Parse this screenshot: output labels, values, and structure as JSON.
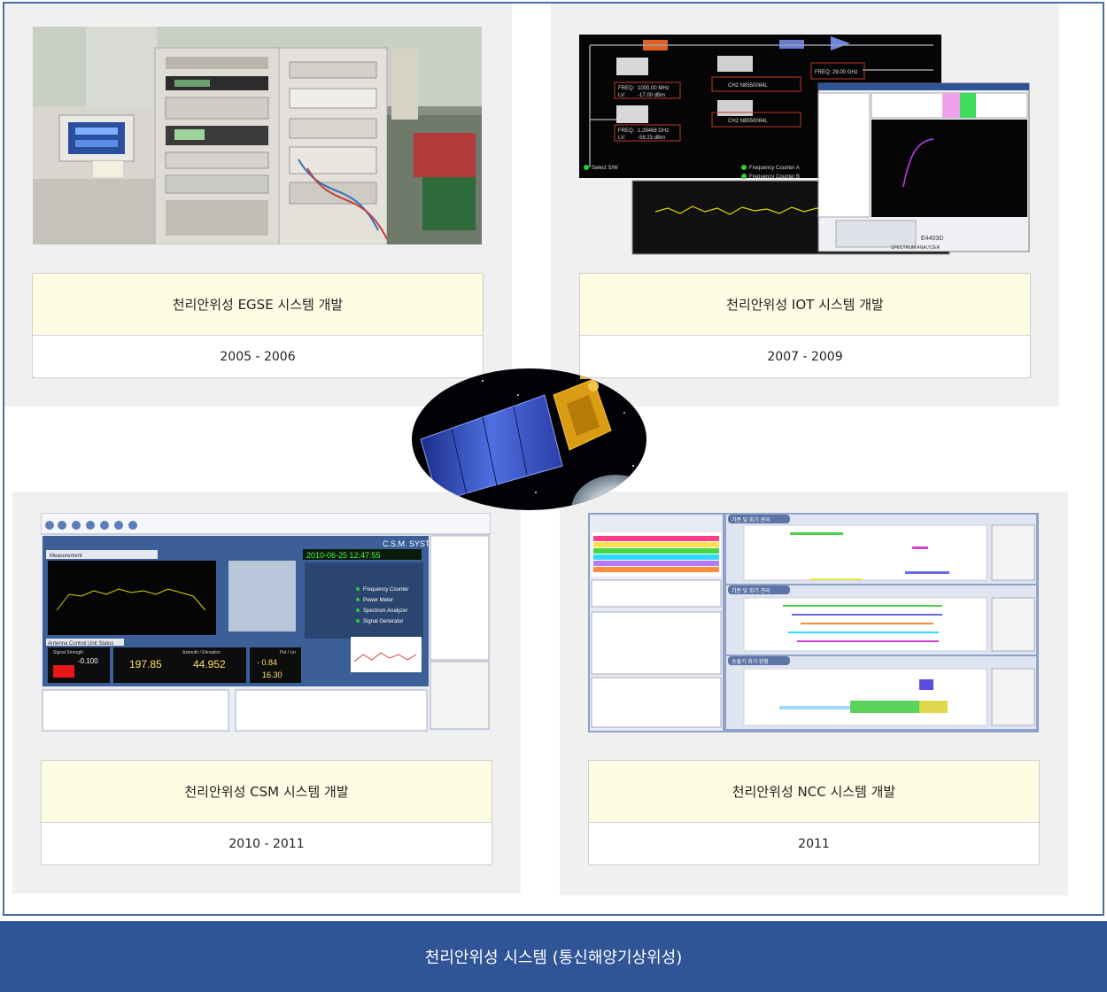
{
  "projects": [
    {
      "title": "천리안위성 EGSE 시스템 개발",
      "period": "2005 - 2006"
    },
    {
      "title": "천리안위성 IOT 시스템 개발",
      "period": "2007 - 2009"
    },
    {
      "title": "천리안위성 CSM 시스템 개발",
      "period": "2010 - 2011"
    },
    {
      "title": "천리안위성 NCC 시스템 개발",
      "period": "2011"
    }
  ],
  "iot_labels": {
    "freq_a": "FREQ:",
    "freq_a_val": "1000.00 MHz",
    "lv_a": "LV:",
    "lv_a_val": "-17.00 dBm",
    "freq_b": "FREQ:",
    "freq_b_val": "1.28468 GHz",
    "lv_b": "LV:",
    "lv_b_val": "-58.23 dBm",
    "freq_c": "FREQ:",
    "freq_c_val": "29.00 GHz",
    "box1": "CH2 N8550084L",
    "box2": "CH2 N8550084L",
    "select": "Select S/W",
    "fc_a": "Frequency Counter A",
    "fc_b": "Frequency Counter B",
    "model": "E4403D",
    "sa": "SPECTRUM ANALYZER"
  },
  "csm_labels": {
    "system": "C.S.M. SYSTEM",
    "clock": "2010-06-25  12:47:55",
    "measurement": "Measurement",
    "acu": "Antenna Control Unit Status",
    "signal": "Signal Strength",
    "az": "Azimuth / Elevation",
    "pol": "Pol / Lin",
    "sig_val": "-0.100",
    "az_val": "197.85",
    "el_val": "44.952",
    "pol1": "- 0.84",
    "pol2": "16.30",
    "fc": "Frequency Counter",
    "pm": "Power Meter",
    "sa": "Spectrum Analyzer",
    "sg": "Signal Generator"
  },
  "ncc_labels": {
    "t1": "기준 및 회기 관리",
    "t2": "기준 및 회기 관리",
    "t3": "송출기 회기 현황"
  },
  "footer_title": "천리안위성 시스템 (통신해양기상위성)"
}
